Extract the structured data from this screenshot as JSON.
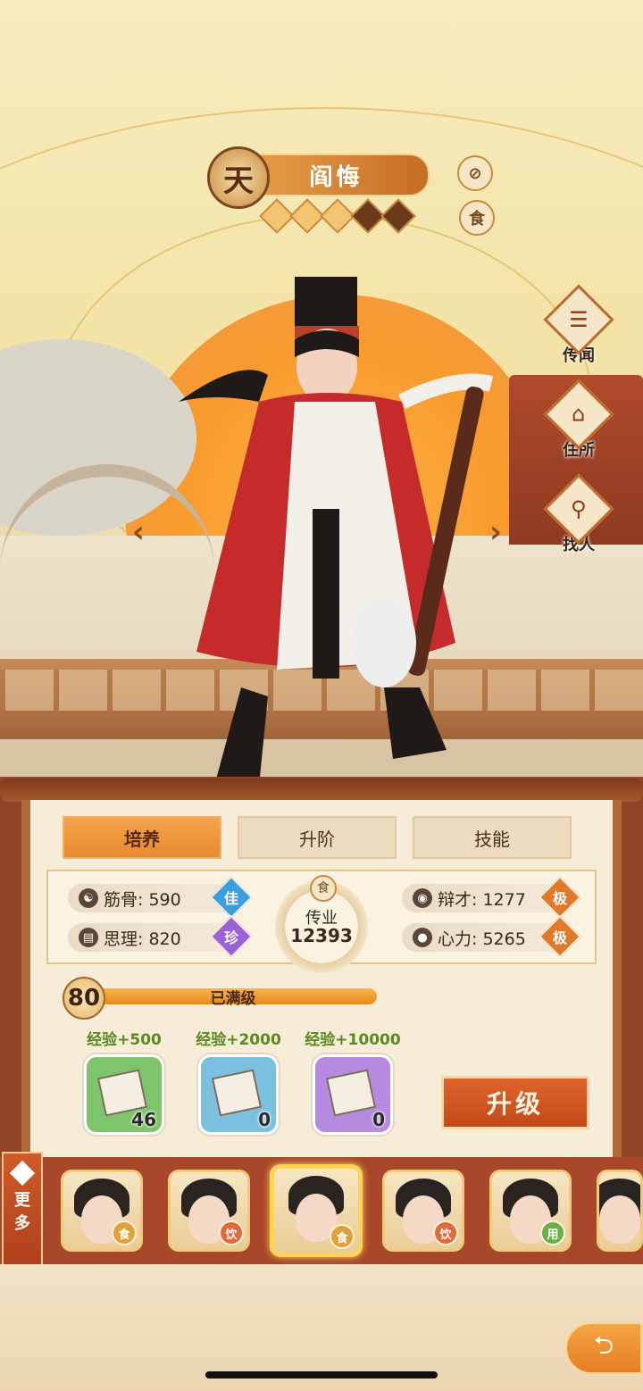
{
  "character": {
    "rank": "天",
    "name": "阎悔",
    "stars_filled": 3,
    "stars_total": 5,
    "attribute_icon": "食"
  },
  "side_menu": [
    {
      "label": "传闻",
      "icon": "scroll-icon",
      "glyph": "☰"
    },
    {
      "label": "住所",
      "icon": "house-icon",
      "glyph": "⌂"
    },
    {
      "label": "找人",
      "icon": "search-person-icon",
      "glyph": "⚲"
    }
  ],
  "tabs": [
    {
      "label": "培养",
      "active": true
    },
    {
      "label": "升阶",
      "active": false
    },
    {
      "label": "技能",
      "active": false
    }
  ],
  "stats": {
    "jingu": {
      "label": "筋骨: 590",
      "grade": "佳",
      "grade_color": "#3a9fe0"
    },
    "sili": {
      "label": "思理: 820",
      "grade": "珍",
      "grade_color": "#9a62d8"
    },
    "biancai": {
      "label": "辩才: 1277",
      "grade": "极",
      "grade_color": "#e07a2a"
    },
    "xinli": {
      "label": "心力: 5265",
      "grade": "极",
      "grade_color": "#e07a2a"
    },
    "center": {
      "icon": "食",
      "label": "传业",
      "value": "12393"
    }
  },
  "level": {
    "value": "80",
    "status": "已满级",
    "progress": 1.0
  },
  "exp_items": [
    {
      "label": "经验+500",
      "count": "46",
      "color": "#7ec46a"
    },
    {
      "label": "经验+2000",
      "count": "0",
      "color": "#7cc0e0"
    },
    {
      "label": "经验+10000",
      "count": "0",
      "color": "#b58ae0"
    }
  ],
  "upgrade_label": "升级",
  "more": {
    "label1": "更",
    "label2": "多"
  },
  "roster": [
    {
      "type": "食",
      "type_color": "#e0a13a",
      "selected": false
    },
    {
      "type": "饮",
      "type_color": "#e06a3a",
      "selected": false
    },
    {
      "type": "食",
      "type_color": "#e0a13a",
      "selected": true
    },
    {
      "type": "饮",
      "type_color": "#e06a3a",
      "selected": false
    },
    {
      "type": "用",
      "type_color": "#6ab04a",
      "selected": false
    },
    {
      "type": "",
      "type_color": "#e0a13a",
      "selected": false
    }
  ],
  "colors": {
    "accent": "#e88a30",
    "panel": "#f6ecd8",
    "roster_bg": "#a8472a"
  }
}
